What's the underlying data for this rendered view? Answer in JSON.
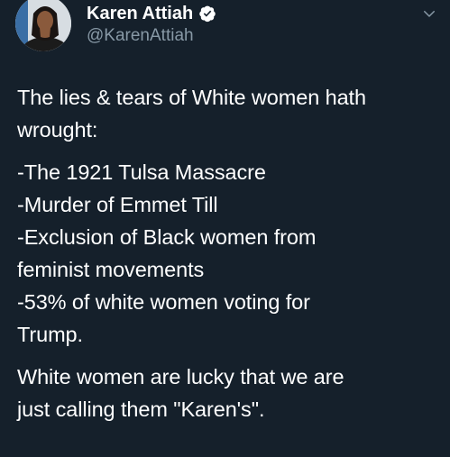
{
  "author": {
    "display_name": "Karen Attiah",
    "handle": "@KarenAttiah",
    "verified": true,
    "avatar_icon": "profile-photo"
  },
  "menu": {
    "icon": "chevron-down-icon"
  },
  "tweet": {
    "intro": [
      "The lies & tears of White women hath",
      "wrought:"
    ],
    "list": [
      "-The 1921 Tulsa Massacre",
      "-Murder of Emmet Till",
      "-Exclusion of Black women from",
      "feminist movements",
      "-53% of white women voting for",
      "Trump."
    ],
    "closing": [
      "White women are lucky that we are",
      "just calling them \"Karen's\"."
    ]
  },
  "colors": {
    "background": "#15202b",
    "text": "#ffffff",
    "secondary_text": "#8899a6",
    "verified_badge": "#ffffff"
  }
}
